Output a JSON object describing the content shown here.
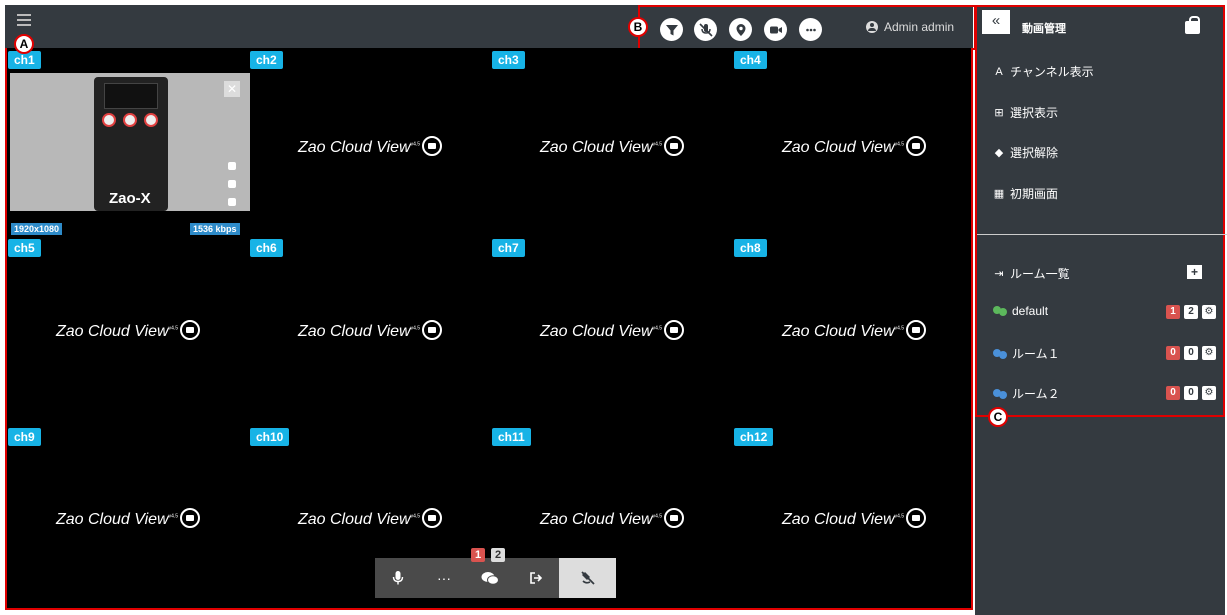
{
  "user": {
    "name": "Admin admin"
  },
  "callouts": {
    "a": "A",
    "b": "B",
    "c": "C"
  },
  "toolbar": {
    "icons": [
      "filter-icon",
      "mic-off-icon",
      "location-icon",
      "video-camera-icon",
      "more-icon",
      "user-icon"
    ]
  },
  "grid": {
    "brand": "Zao Cloud View",
    "brand_version": "v4.5",
    "channels": [
      "ch1",
      "ch2",
      "ch3",
      "ch4",
      "ch5",
      "ch6",
      "ch7",
      "ch8",
      "ch9",
      "ch10",
      "ch11",
      "ch12"
    ],
    "live": {
      "device_name": "Zao-X",
      "close": "✕",
      "resolution": "1920x1080",
      "bitrate": "1536 kbps"
    }
  },
  "controls": {
    "more": "···",
    "chat_badges": [
      "1",
      "2"
    ]
  },
  "panel": {
    "collapse": "«",
    "title": "動画管理",
    "menu": [
      {
        "icon": "A",
        "label": "チャンネル表示"
      },
      {
        "icon": "⊞",
        "label": "選択表示"
      },
      {
        "icon": "◆",
        "label": "選択解除"
      },
      {
        "icon": "▦",
        "label": "初期画面"
      }
    ],
    "rooms_title": "ルーム一覧",
    "add": "+",
    "rooms": [
      {
        "name": "default",
        "color": "green",
        "badges": [
          "1",
          "2"
        ],
        "first_red": true
      },
      {
        "name": "ルーム１",
        "color": "blue",
        "badges": [
          "0",
          "0"
        ],
        "first_red": true
      },
      {
        "name": "ルーム２",
        "color": "blue",
        "badges": [
          "0",
          "0"
        ],
        "first_red": true
      }
    ]
  },
  "colors": {
    "accent": "#17b3e6",
    "callout_border": "#e00000",
    "bar": "#343a40",
    "badge_red": "#d9534f"
  }
}
